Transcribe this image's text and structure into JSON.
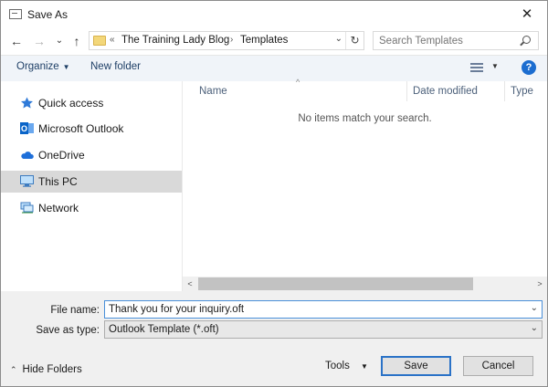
{
  "window": {
    "title": "Save As",
    "close_glyph": "✕"
  },
  "nav_buttons": {
    "back": "←",
    "forward": "→",
    "recent": "⌄",
    "up": "↑"
  },
  "address": {
    "chevrons": "«",
    "breadcrumbs": [
      "The Training Lady Blog",
      "Templates"
    ],
    "separator": "›",
    "dropdown": "⌄",
    "refresh": "↻"
  },
  "search": {
    "placeholder": "Search Templates"
  },
  "toolbar": {
    "organize": "Organize",
    "organize_caret": "▼",
    "new_folder": "New folder",
    "view_caret": "▼",
    "help": "?"
  },
  "nav_pane": {
    "items": [
      {
        "label": "Quick access",
        "icon": "star-icon"
      },
      {
        "label": "Microsoft Outlook",
        "icon": "outlook-icon"
      },
      {
        "label": "OneDrive",
        "icon": "cloud-icon"
      },
      {
        "label": "This PC",
        "icon": "computer-icon",
        "selected": true
      },
      {
        "label": "Network",
        "icon": "network-icon"
      }
    ]
  },
  "file_list": {
    "columns": [
      "Name",
      "Date modified",
      "Type"
    ],
    "sort_indicator": "^",
    "empty_message": "No items match your search.",
    "scroll_left": "<",
    "scroll_right": ">"
  },
  "form": {
    "file_name_label": "File name:",
    "file_name_value": "Thank you for your inquiry.oft",
    "save_as_type_label": "Save as type:",
    "save_as_type_value": "Outlook Template (*.oft)",
    "dropdown_glyph": "⌄"
  },
  "footer": {
    "hide_folders": "Hide Folders",
    "hide_folders_chevron": "⌃",
    "tools": "Tools",
    "tools_caret": "▼",
    "save": "Save",
    "cancel": "Cancel"
  },
  "colors": {
    "accent": "#1c6dd0",
    "selected_nav": "#d9d9d9",
    "folder": "#f3d77a"
  }
}
